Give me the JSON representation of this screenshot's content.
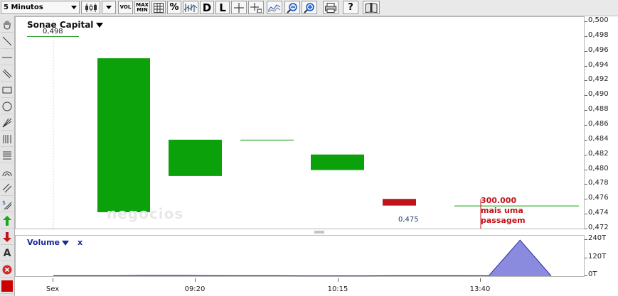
{
  "toolbar": {
    "timeframe": "5 Minutos",
    "vol_label": "VOL",
    "maxmin_top": "MAX",
    "maxmin_bottom": "MIN",
    "percent_label": "%",
    "d_label": "D",
    "l_label": "L"
  },
  "chart": {
    "instrument": "Sonae Capital",
    "open_ref_label": "0,498",
    "low_label": "0,475",
    "volume_note_lines": [
      "300.000",
      "mais uma",
      "passagem"
    ],
    "watermark": "negocios"
  },
  "volume_panel": {
    "title": "Volume",
    "close_label": "x"
  },
  "colors": {
    "up": "#0aa10a",
    "down": "#c0141b",
    "volume_fill": "#8a8adf",
    "volume_line": "#2a2aa6",
    "note_text": "#c0141b"
  },
  "chart_data": {
    "type": "candlestick",
    "title": "Sonae Capital",
    "price_axis": {
      "ylim": [
        0.472,
        0.5
      ],
      "ticks": [
        "0,472",
        "0,474",
        "0,476",
        "0,478",
        "0,480",
        "0,482",
        "0,484",
        "0,486",
        "0,488",
        "0,490",
        "0,492",
        "0,494",
        "0,496",
        "0,498",
        "0,500"
      ]
    },
    "candles": [
      {
        "open": 0.4743,
        "close": 0.4951,
        "color": "up"
      },
      {
        "open": 0.4792,
        "close": 0.4841,
        "color": "up"
      },
      {
        "open": 0.4841,
        "close": 0.4841,
        "color": "up"
      },
      {
        "open": 0.48,
        "close": 0.4821,
        "color": "up"
      },
      {
        "open": 0.4761,
        "close": 0.4752,
        "color": "down"
      },
      {
        "open": 0.4752,
        "close": 0.4752,
        "color": "up"
      }
    ],
    "volume": {
      "ticks": [
        "0T",
        "120T",
        "240T"
      ],
      "ylim": [
        0,
        260
      ],
      "values": [
        3,
        3,
        3,
        5,
        5,
        4,
        3,
        3,
        2,
        2,
        2,
        3,
        3,
        3,
        4,
        240,
        2
      ]
    },
    "time_axis": {
      "labels": [
        "Sex",
        "09:20",
        "10:15",
        "13:40"
      ]
    }
  }
}
